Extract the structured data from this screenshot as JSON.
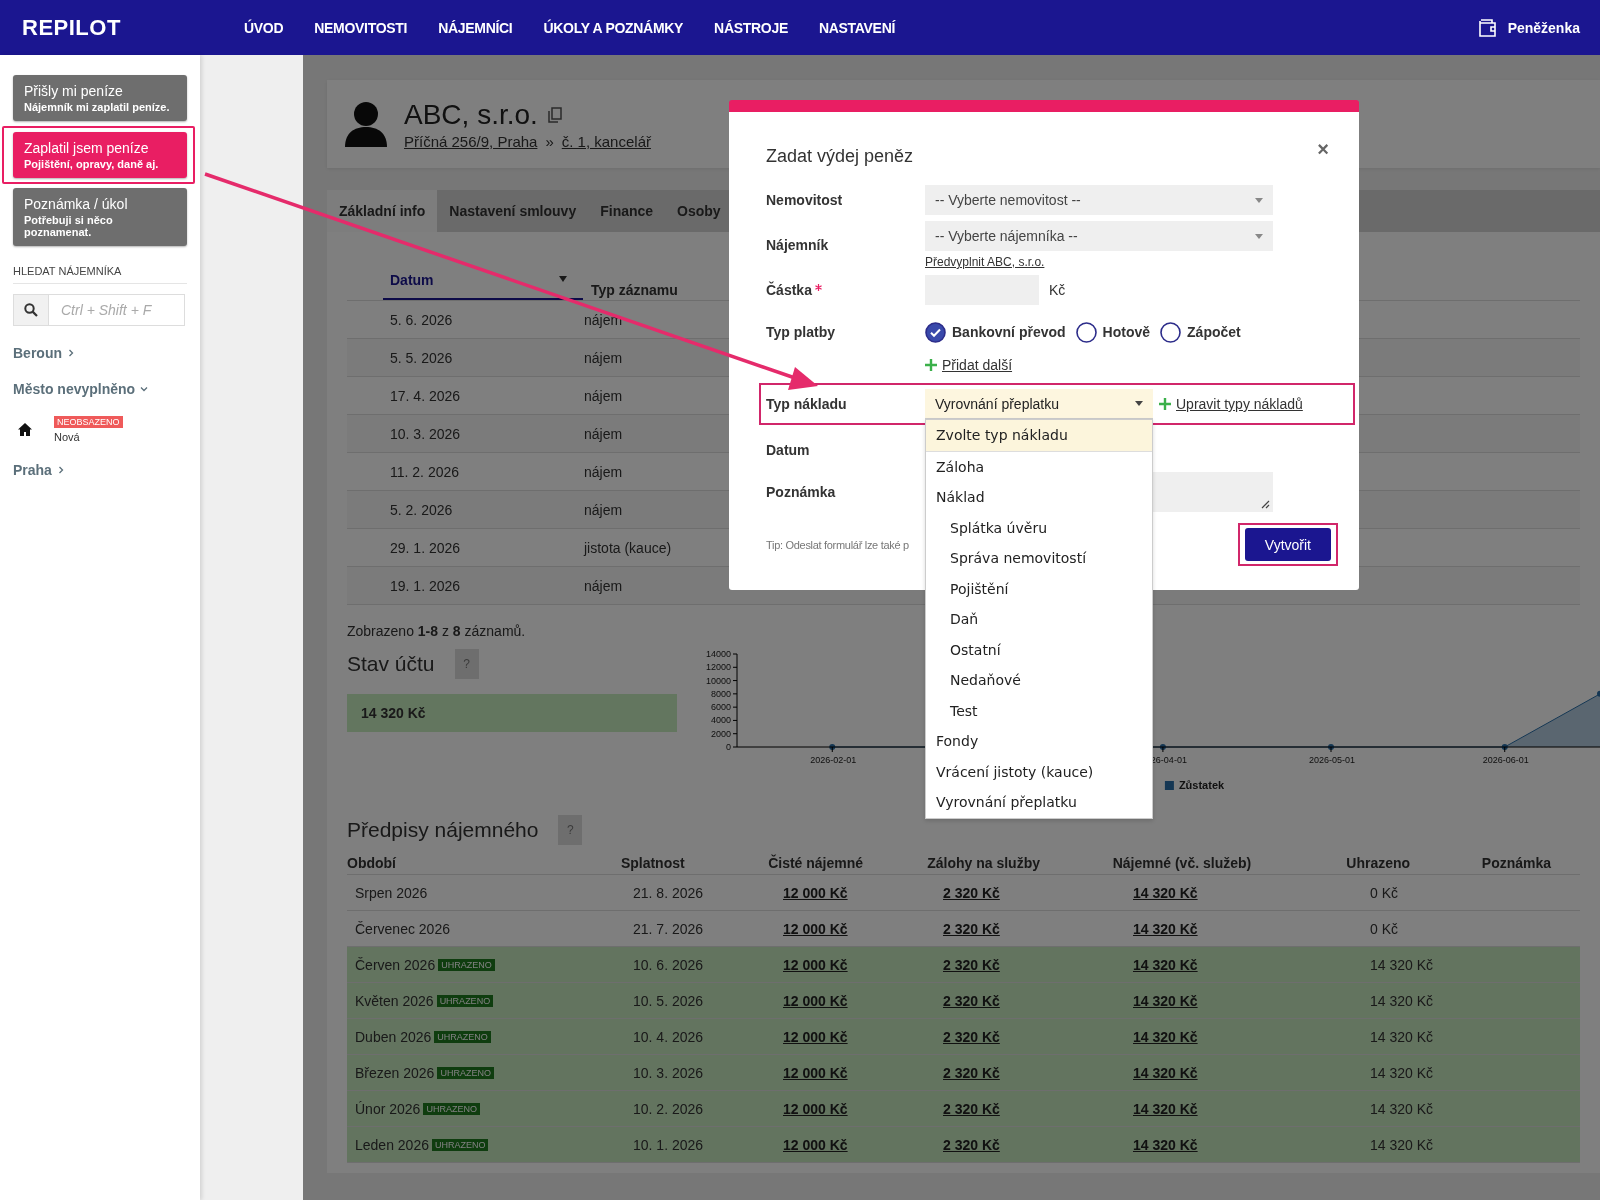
{
  "top_bar": {
    "logo": "REPILOT",
    "nav": [
      {
        "label": "ÚVOD"
      },
      {
        "label": "NEMOVITOSTI"
      },
      {
        "label": "NÁJEMNÍCI"
      },
      {
        "label": "ÚKOLY A POZNÁMKY"
      },
      {
        "label": "NÁSTROJE"
      },
      {
        "label": "NASTAVENÍ"
      }
    ],
    "wallet": "Peněženka"
  },
  "sidebar": {
    "actions": [
      {
        "title": "Přišly mi peníze",
        "subtitle": "Nájemník mi zaplatil peníze.",
        "selected": false,
        "annotated": false
      },
      {
        "title": "Zaplatil jsem peníze",
        "subtitle": "Pojištění, opravy, daně aj.",
        "selected": true,
        "annotated": true
      },
      {
        "title": "Poznámka / úkol",
        "subtitle": "Potřebuji si něco poznamenat.",
        "selected": false,
        "annotated": false
      }
    ],
    "search": {
      "label": "HLEDAT NÁJEMNÍKA",
      "placeholder": "Ctrl + Shift + F"
    },
    "tree": [
      {
        "label": "Beroun",
        "expanded": false
      },
      {
        "label": "Město nevyplněno",
        "expanded": true,
        "children": [
          {
            "badge": "NEOBSAZENO",
            "name": "Nová"
          }
        ]
      },
      {
        "label": "Praha",
        "expanded": false
      }
    ]
  },
  "tenant": {
    "name": "ABC, s.r.o.",
    "address": "Příčná 256/9, Praha",
    "separator": "»",
    "unit": "č. 1, kancelář"
  },
  "tabs": [
    {
      "label": "Základní info",
      "selected": true
    },
    {
      "label": "Nastavení smlouvy",
      "selected": false
    },
    {
      "label": "Finance",
      "selected": false
    },
    {
      "label": "Osoby",
      "selected": false
    }
  ],
  "records": {
    "columns": [
      {
        "label": "Datum",
        "sorted": true
      },
      {
        "label": "Typ záznamu",
        "sorted": false
      }
    ],
    "rows": [
      {
        "date": "5. 6. 2026",
        "type": "nájem"
      },
      {
        "date": "5. 5. 2026",
        "type": "nájem"
      },
      {
        "date": "17. 4. 2026",
        "type": "nájem"
      },
      {
        "date": "10. 3. 2026",
        "type": "nájem"
      },
      {
        "date": "11. 2. 2026",
        "type": "nájem"
      },
      {
        "date": "5. 2. 2026",
        "type": "nájem"
      },
      {
        "date": "29. 1. 2026",
        "type": "jistota (kauce)"
      },
      {
        "date": "19. 1. 2026",
        "type": "nájem"
      }
    ],
    "summary": "Zobrazeno **1-8** z **8** záznamů."
  },
  "balance": {
    "title": "Stav účtu",
    "help": "?",
    "amount": "14 320 Kč",
    "chart_data": {
      "type": "area",
      "x": [
        "2026-02-01",
        "2026-04-01",
        "2026-05-01",
        "2026-06-01",
        "2026-06-18"
      ],
      "series": [
        {
          "name": "Zůstatek",
          "color": "#2a6fa8",
          "values": [
            0,
            0,
            0,
            0,
            8000
          ]
        }
      ],
      "xlim": [
        "2026-01-15",
        "2026-06-18"
      ],
      "ylim": [
        0,
        14000
      ],
      "xticks": [
        {
          "value": "2026-02-01",
          "label": "2026-02-01"
        },
        {
          "value": "2026-04-01",
          "label": "26-04-01"
        },
        {
          "value": "2026-05-01",
          "label": "2026-05-01"
        },
        {
          "value": "2026-06-01",
          "label": "2026-06-01"
        }
      ],
      "yticks": [
        0,
        2000,
        4000,
        6000,
        8000,
        10000,
        12000,
        14000
      ]
    }
  },
  "rent": {
    "title": "Předpisy nájemného",
    "help": "?",
    "columns": [
      "Období",
      "Splatnost",
      "Čisté nájemné",
      "Zálohy na služby",
      "Nájemné (vč. služeb)",
      "Uhrazeno",
      "Poznámka"
    ],
    "rows": [
      {
        "period": "Srpen 2026",
        "settled": false,
        "due": "21. 8. 2026",
        "net": "12 000 Kč",
        "services": "2 320 Kč",
        "total": "14 320 Kč",
        "paid": "0 Kč"
      },
      {
        "period": "Červenec 2026",
        "settled": false,
        "due": "21. 7. 2026",
        "net": "12 000 Kč",
        "services": "2 320 Kč",
        "total": "14 320 Kč",
        "paid": "0 Kč"
      },
      {
        "period": "Červen 2026",
        "badge": "UHRAZENO",
        "settled": true,
        "due": "10. 6. 2026",
        "net": "12 000 Kč",
        "services": "2 320 Kč",
        "total": "14 320 Kč",
        "paid": "14 320 Kč"
      },
      {
        "period": "Květen 2026",
        "badge": "UHRAZENO",
        "settled": true,
        "due": "10. 5. 2026",
        "net": "12 000 Kč",
        "services": "2 320 Kč",
        "total": "14 320 Kč",
        "paid": "14 320 Kč"
      },
      {
        "period": "Duben 2026",
        "badge": "UHRAZENO",
        "settled": true,
        "due": "10. 4. 2026",
        "net": "12 000 Kč",
        "services": "2 320 Kč",
        "total": "14 320 Kč",
        "paid": "14 320 Kč"
      },
      {
        "period": "Březen 2026",
        "badge": "UHRAZENO",
        "settled": true,
        "due": "10. 3. 2026",
        "net": "12 000 Kč",
        "services": "2 320 Kč",
        "total": "14 320 Kč",
        "paid": "14 320 Kč"
      },
      {
        "period": "Únor 2026",
        "badge": "UHRAZENO",
        "settled": true,
        "due": "10. 2. 2026",
        "net": "12 000 Kč",
        "services": "2 320 Kč",
        "total": "14 320 Kč",
        "paid": "14 320 Kč"
      },
      {
        "period": "Leden 2026",
        "badge": "UHRAZENO",
        "settled": true,
        "due": "10. 1. 2026",
        "net": "12 000 Kč",
        "services": "2 320 Kč",
        "total": "14 320 Kč",
        "paid": "14 320 Kč"
      }
    ]
  },
  "modal": {
    "title": "Zadat výdej peněz",
    "close": "×",
    "property": {
      "label": "Nemovitost",
      "placeholder": "-- Vyberte nemovitost --"
    },
    "tenant": {
      "label": "Nájemník",
      "placeholder": "-- Vyberte nájemníka --",
      "prefill_link": "Předvyplnit ABC, s.r.o."
    },
    "amount": {
      "label": "Částka",
      "required": true,
      "unit": "Kč"
    },
    "payment": {
      "label": "Typ platby",
      "options": [
        {
          "label": "Bankovní převod",
          "selected": true
        },
        {
          "label": "Hotově",
          "selected": false
        },
        {
          "label": "Zápočet",
          "selected": false
        }
      ],
      "add_link": "Přidat další"
    },
    "cost_type": {
      "label": "Typ nákladu",
      "value": "Vyrovnání přeplatku",
      "annotated": true,
      "edit_link": "Upravit typy nákladů",
      "open": true,
      "options": [
        {
          "label": "Zvolte typ nákladu",
          "highlighted": true
        },
        {
          "label": "Záloha",
          "highlighted": false
        },
        {
          "label": "Náklad",
          "highlighted": false,
          "children": [
            {
              "label": "Splátka úvěru",
              "highlighted": false
            },
            {
              "label": "Správa nemovitostí",
              "highlighted": false
            },
            {
              "label": "Pojištění",
              "highlighted": false
            },
            {
              "label": "Daň",
              "highlighted": false
            },
            {
              "label": "Ostatní",
              "highlighted": false
            },
            {
              "label": "Nedaňové",
              "highlighted": false
            },
            {
              "label": "Test",
              "highlighted": false
            }
          ]
        },
        {
          "label": "Fondy",
          "highlighted": false
        },
        {
          "label": "Vrácení jistoty (kauce)",
          "highlighted": false
        },
        {
          "label": "Vyrovnání přeplatku",
          "highlighted": false
        }
      ]
    },
    "date": {
      "label": "Datum"
    },
    "note": {
      "label": "Poznámka"
    },
    "tip": "Tip: Odeslat formulář lze také p",
    "submit": {
      "label": "Vytvořit",
      "annotated": true
    }
  }
}
